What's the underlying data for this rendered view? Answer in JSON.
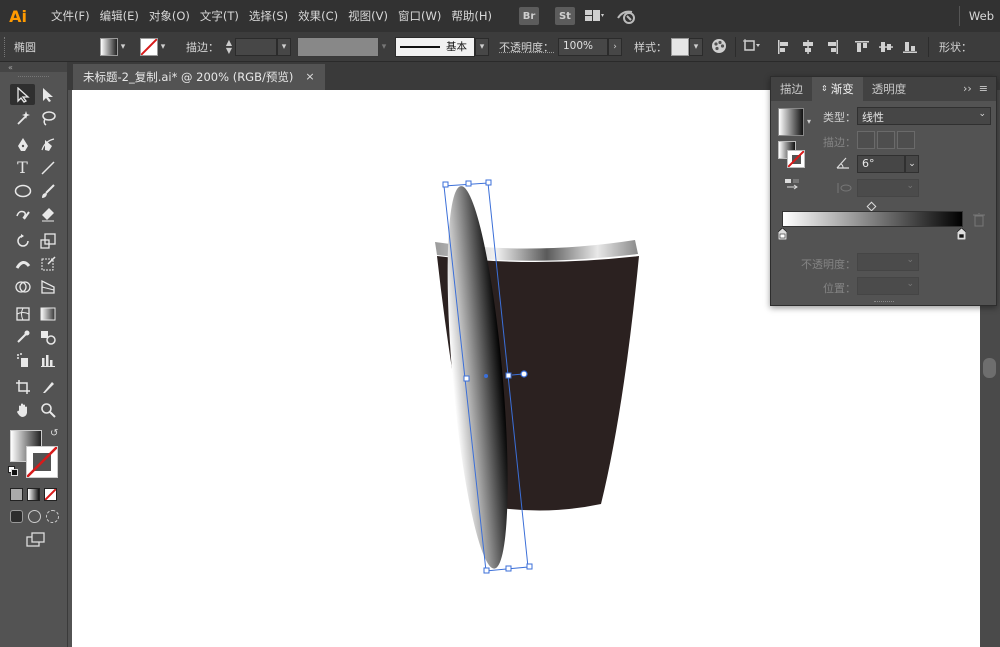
{
  "app": {
    "logo": "Ai"
  },
  "menu": {
    "items": [
      "文件(F)",
      "编辑(E)",
      "对象(O)",
      "文字(T)",
      "选择(S)",
      "效果(C)",
      "视图(V)",
      "窗口(W)",
      "帮助(H)"
    ],
    "bridge": "Br",
    "stock": "St",
    "workspace": "Web"
  },
  "control_bar": {
    "object_type": "椭圆",
    "stroke_label": "描边：",
    "brush_label": "基本",
    "opacity_label": "不透明度：",
    "opacity_value": "100%",
    "style_label": "样式：",
    "shape_label": "形状："
  },
  "document": {
    "tab_title": "未标题-2_复制.ai* @ 200% (RGB/预览)",
    "close_glyph": "×"
  },
  "gradient_panel": {
    "tabs": [
      "描边",
      "渐变",
      "透明度"
    ],
    "active_tab": "渐变",
    "type_label": "类型：",
    "type_value": "线性",
    "stroke_label": "描边：",
    "angle_value": "6°",
    "opacity_label": "不透明度：",
    "location_label": "位置："
  },
  "colors": {
    "accent": "#ff9a00",
    "selection": "#3b6fd8",
    "cup_body": "#2b2120",
    "none_slash": "#d81b1b"
  },
  "icons": {
    "menu_workspace": [
      "grid-layout-icon",
      "gpu-icon"
    ],
    "panel_menu": "panel-menu-icon"
  }
}
